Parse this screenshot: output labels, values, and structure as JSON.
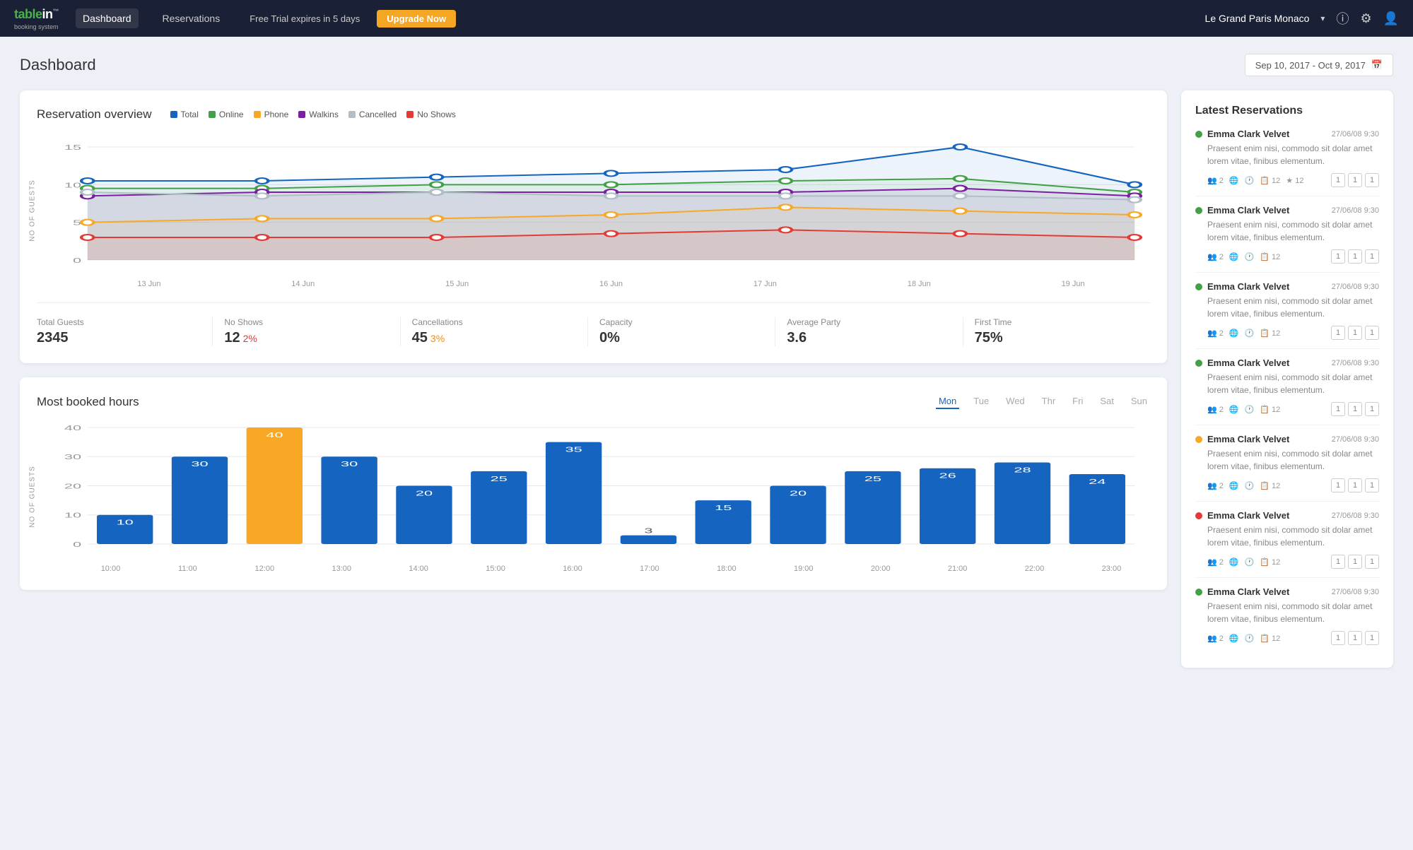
{
  "navbar": {
    "logo": "table in",
    "logo_sub": "booking system",
    "links": [
      "Dashboard",
      "Reservations"
    ],
    "active_link": "Dashboard",
    "trial_text": "Free Trial expires in 5 days",
    "upgrade_label": "Upgrade Now",
    "restaurant": "Le Grand Paris Monaco"
  },
  "page": {
    "title": "Dashboard",
    "date_range": "Sep 10, 2017 - Oct 9, 2017"
  },
  "reservation_overview": {
    "title": "Reservation overview",
    "legend": [
      {
        "label": "Total",
        "color": "#1565c0"
      },
      {
        "label": "Online",
        "color": "#43a047"
      },
      {
        "label": "Phone",
        "color": "#f9a825"
      },
      {
        "label": "Walkins",
        "color": "#7b1fa2"
      },
      {
        "label": "Cancelled",
        "color": "#b0bec5"
      },
      {
        "label": "No Shows",
        "color": "#e53935"
      }
    ],
    "x_labels": [
      "13 Jun",
      "14 Jun",
      "15 Jun",
      "16 Jun",
      "17 Jun",
      "18 Jun",
      "19 Jun"
    ],
    "y_label": "NO OF GUESTS",
    "y_max": 15,
    "y_step": 5
  },
  "stats": [
    {
      "label": "Total Guests",
      "value": "2345",
      "suffix": "",
      "suffix_color": ""
    },
    {
      "label": "No Shows",
      "value": "12",
      "suffix": "2%",
      "suffix_color": "red"
    },
    {
      "label": "Cancellations",
      "value": "45",
      "suffix": "3%",
      "suffix_color": "orange"
    },
    {
      "label": "Capacity",
      "value": "0%",
      "suffix": "",
      "suffix_color": ""
    },
    {
      "label": "Average Party",
      "value": "3.6",
      "suffix": "",
      "suffix_color": ""
    },
    {
      "label": "First Time",
      "value": "75%",
      "suffix": "",
      "suffix_color": ""
    }
  ],
  "most_booked": {
    "title": "Most booked hours",
    "y_label": "NO OF GUESTS",
    "days": [
      "Mon",
      "Tue",
      "Wed",
      "Thr",
      "Fri",
      "Sat",
      "Sun"
    ],
    "active_day": "Mon",
    "x_labels": [
      "10:00",
      "11:00",
      "12:00",
      "13:00",
      "14:00",
      "15:00",
      "16:00",
      "17:00",
      "18:00",
      "19:00",
      "20:00",
      "21:00",
      "22:00",
      "23:00"
    ],
    "bars": [
      10,
      30,
      40,
      30,
      20,
      25,
      35,
      3,
      15,
      20,
      25,
      26,
      28,
      24
    ],
    "active_bar_index": 2,
    "y_max": 40,
    "y_step": 10
  },
  "latest_reservations": {
    "title": "Latest Reservations",
    "items": [
      {
        "name": "Emma Clark Velvet",
        "date": "27/06/08 9:30",
        "dot_color": "#43a047",
        "desc": "Praesent enim nisi, commodo sit dolar amet lorem vitae, finibus elementum.",
        "guests": "2",
        "count": "12",
        "star": "12",
        "tags": [
          "1",
          "1",
          "1"
        ]
      },
      {
        "name": "Emma Clark Velvet",
        "date": "27/06/08 9:30",
        "dot_color": "#43a047",
        "desc": "Praesent enim nisi, commodo sit dolar amet lorem vitae, finibus elementum.",
        "guests": "2",
        "count": "12",
        "tags": [
          "1",
          "1",
          "1"
        ]
      },
      {
        "name": "Emma Clark Velvet",
        "date": "27/06/08 9:30",
        "dot_color": "#43a047",
        "desc": "Praesent enim nisi, commodo sit dolar amet lorem vitae, finibus elementum.",
        "guests": "2",
        "count": "12",
        "tags": [
          "1",
          "1",
          "1"
        ]
      },
      {
        "name": "Emma Clark Velvet",
        "date": "27/06/08 9:30",
        "dot_color": "#43a047",
        "desc": "Praesent enim nisi, commodo sit dolar amet lorem vitae, finibus elementum.",
        "guests": "2",
        "count": "12",
        "tags": [
          "1",
          "1",
          "1"
        ]
      },
      {
        "name": "Emma Clark Velvet",
        "date": "27/06/08 9:30",
        "dot_color": "#f9a825",
        "desc": "Praesent enim nisi, commodo sit dolar amet lorem vitae, finibus elementum.",
        "guests": "2",
        "count": "12",
        "tags": [
          "1",
          "1",
          "1"
        ]
      },
      {
        "name": "Emma Clark Velvet",
        "date": "27/06/08 9:30",
        "dot_color": "#e53935",
        "desc": "Praesent enim nisi, commodo sit dolar amet lorem vitae, finibus elementum.",
        "guests": "2",
        "count": "12",
        "tags": [
          "1",
          "1",
          "1"
        ]
      },
      {
        "name": "Emma Clark Velvet",
        "date": "27/06/08 9:30",
        "dot_color": "#43a047",
        "desc": "Praesent enim nisi, commodo sit dolar amet lorem vitae, finibus elementum.",
        "guests": "2",
        "count": "12",
        "tags": [
          "1",
          "1",
          "1"
        ]
      }
    ]
  }
}
